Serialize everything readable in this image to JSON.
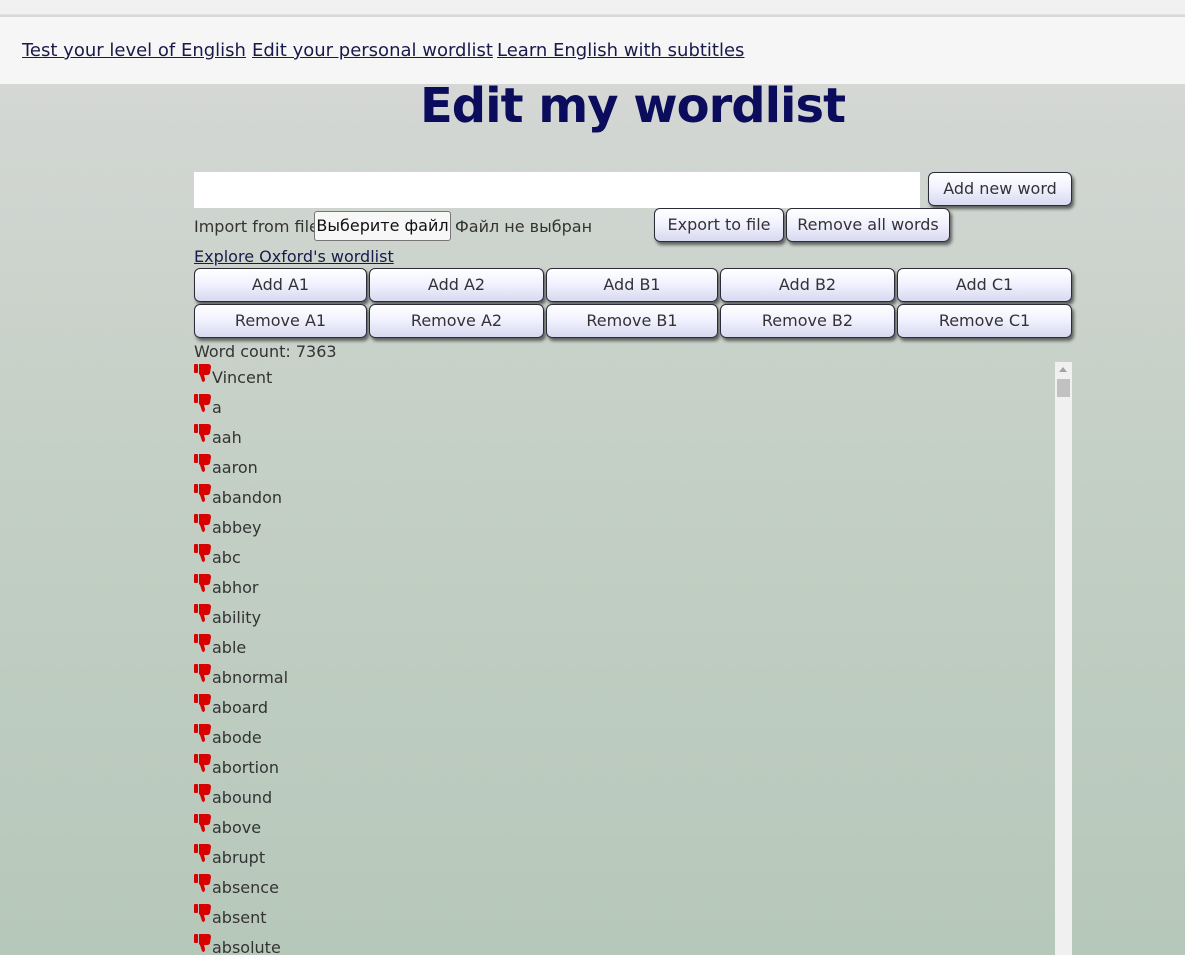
{
  "nav": {
    "links": [
      "Test your level of English",
      "Edit your personal wordlist",
      "Learn English with subtitles"
    ]
  },
  "page": {
    "title": "Edit my wordlist"
  },
  "controls": {
    "add_word_label": "Add new word",
    "import_label": "Import from file:",
    "file_button_label": "Выберите файл",
    "file_status": "Файл не выбран",
    "export_label": "Export to file",
    "remove_all_label": "Remove all words",
    "explore_link": "Explore Oxford's wordlist"
  },
  "level_buttons": {
    "add": [
      "Add A1",
      "Add A2",
      "Add B1",
      "Add B2",
      "Add C1"
    ],
    "remove": [
      "Remove A1",
      "Remove A2",
      "Remove B1",
      "Remove B2",
      "Remove C1"
    ]
  },
  "word_count_text": "Word count: 7363",
  "words": [
    "Vincent",
    "a",
    "aah",
    "aaron",
    "abandon",
    "abbey",
    "abc",
    "abhor",
    "ability",
    "able",
    "abnormal",
    "aboard",
    "abode",
    "abortion",
    "abound",
    "above",
    "abrupt",
    "absence",
    "absent",
    "absolute"
  ],
  "icons": {
    "word_row_icon": "thumbs-down-icon"
  },
  "colors": {
    "heading": "#0c0c5c",
    "link": "#1a1a4a",
    "thumb_icon": "#d90000",
    "button_gradient_bottom": "#d9d9f0"
  }
}
